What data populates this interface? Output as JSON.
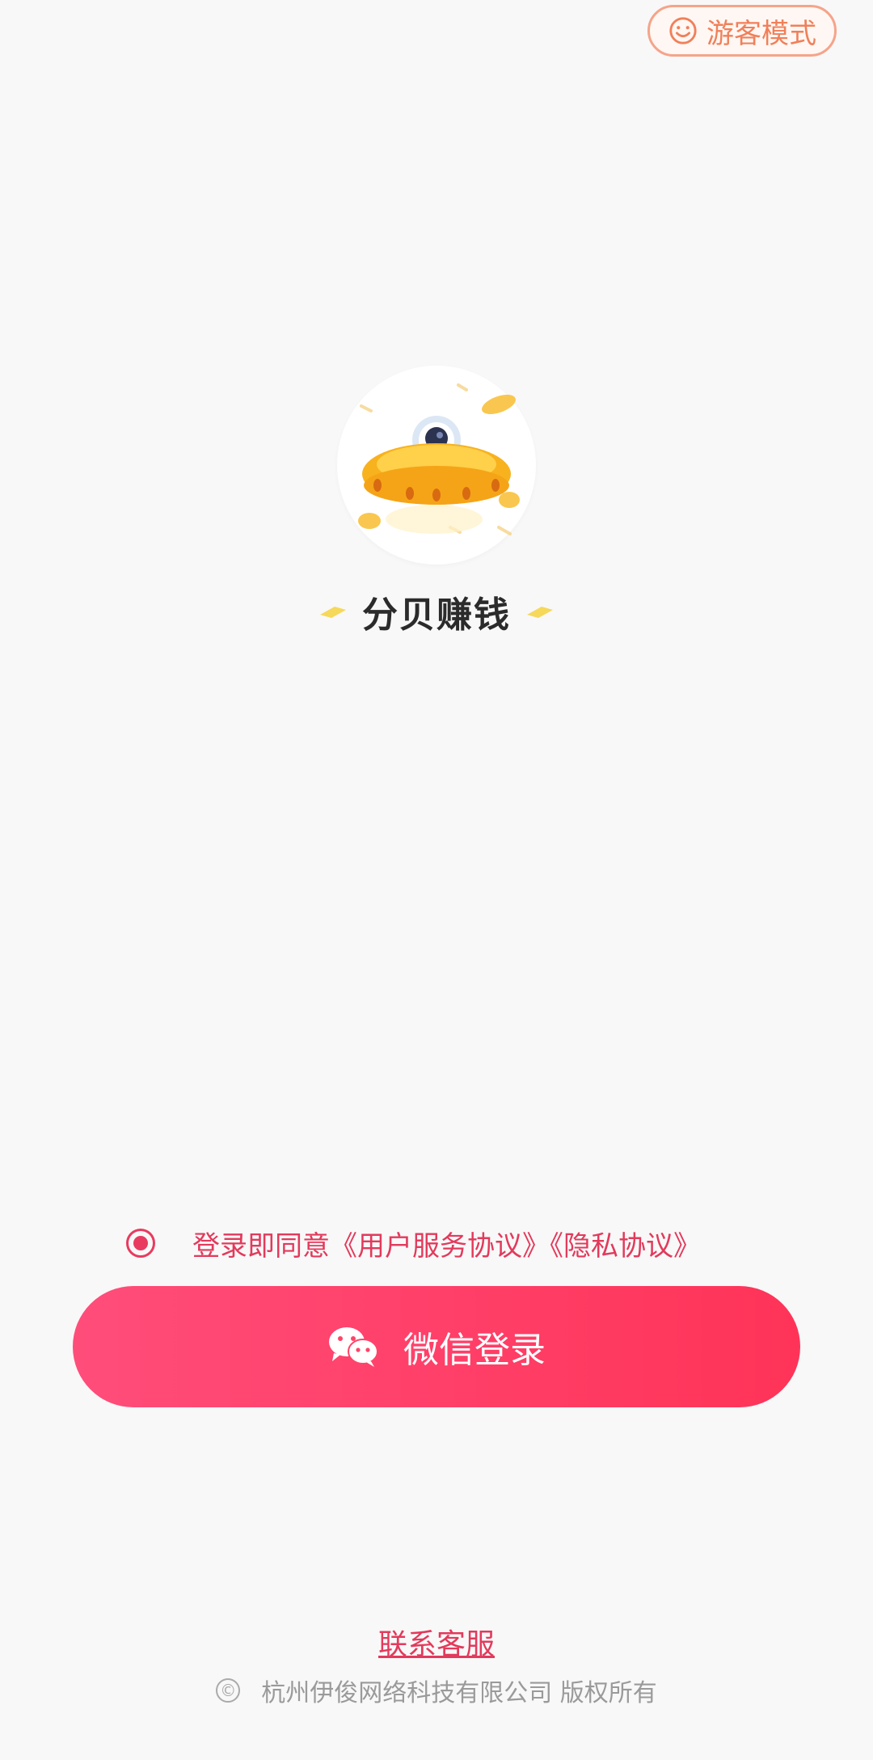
{
  "header": {
    "guest_label": "游客模式"
  },
  "brand": {
    "name": "分贝赚钱"
  },
  "agreement": {
    "prefix": "登录即同意",
    "user_terms": "《用户服务协议》",
    "privacy_terms": "《隐私协议》"
  },
  "login": {
    "wechat_label": "微信登录"
  },
  "footer": {
    "contact_label": "联系客服",
    "copyright_symbol": "©",
    "copyright_text": "杭州伊俊网络科技有限公司 版权所有"
  },
  "colors": {
    "accent": "#e83b5f",
    "button_start": "#ff4d7a",
    "button_end": "#ff3358",
    "guest_border": "#f5a48a",
    "guest_text": "#f0805a"
  }
}
